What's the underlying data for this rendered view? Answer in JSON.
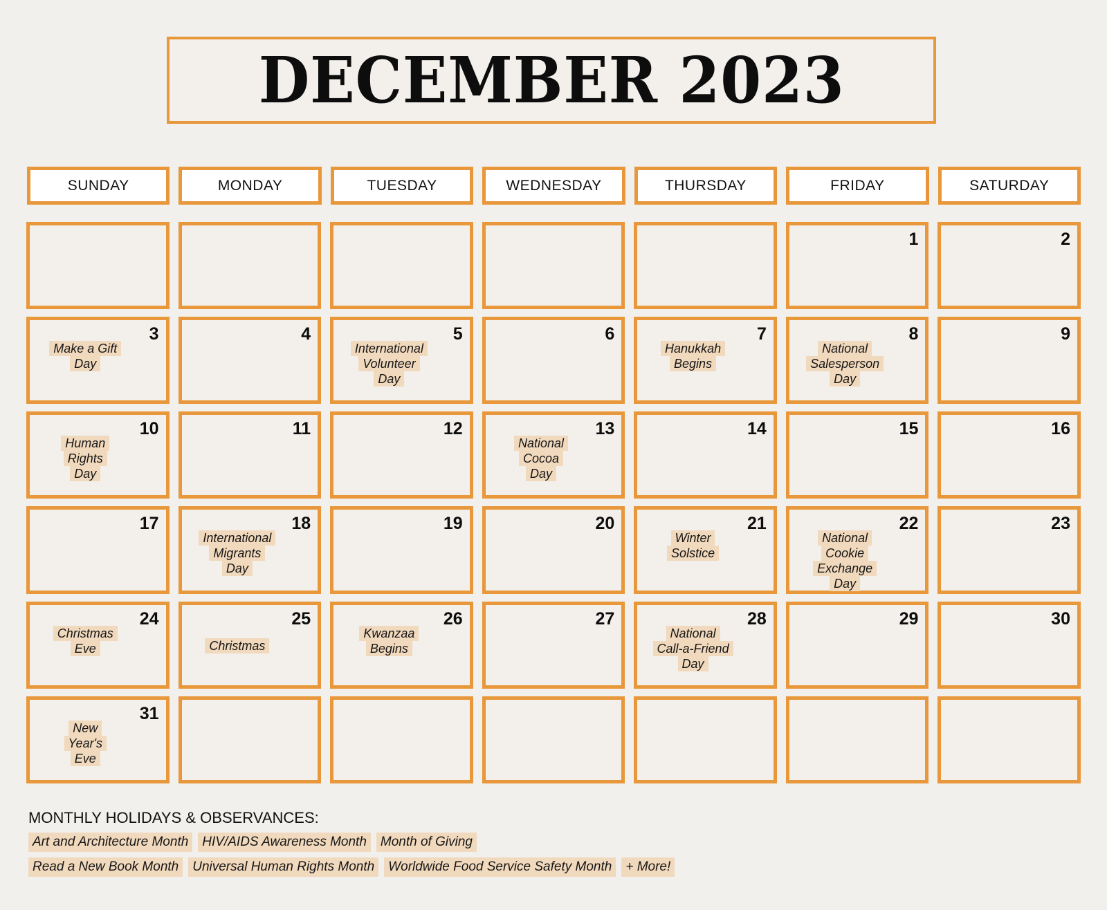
{
  "title": "DECEMBER 2023",
  "weekdays": [
    "SUNDAY",
    "MONDAY",
    "TUESDAY",
    "WEDNESDAY",
    "THURSDAY",
    "FRIDAY",
    "SATURDAY"
  ],
  "colors": {
    "border": "#e8983b",
    "highlight": "#f1d9bd",
    "background": "#f1f0ed"
  },
  "cells": [
    {
      "day": ""
    },
    {
      "day": ""
    },
    {
      "day": ""
    },
    {
      "day": ""
    },
    {
      "day": ""
    },
    {
      "day": "1"
    },
    {
      "day": "2"
    },
    {
      "day": "3",
      "event": [
        "Make a Gift",
        "Day"
      ]
    },
    {
      "day": "4"
    },
    {
      "day": "5",
      "event": [
        "International",
        "Volunteer",
        "Day"
      ]
    },
    {
      "day": "6"
    },
    {
      "day": "7",
      "event": [
        "Hanukkah",
        "Begins"
      ]
    },
    {
      "day": "8",
      "event": [
        "National",
        "Salesperson",
        "Day"
      ]
    },
    {
      "day": "9"
    },
    {
      "day": "10",
      "event": [
        "Human",
        "Rights",
        "Day"
      ]
    },
    {
      "day": "11"
    },
    {
      "day": "12"
    },
    {
      "day": "13",
      "event": [
        "National",
        "Cocoa",
        "Day"
      ]
    },
    {
      "day": "14"
    },
    {
      "day": "15"
    },
    {
      "day": "16"
    },
    {
      "day": "17"
    },
    {
      "day": "18",
      "event": [
        "International",
        "Migrants",
        "Day"
      ]
    },
    {
      "day": "19"
    },
    {
      "day": "20"
    },
    {
      "day": "21",
      "event": [
        "Winter",
        "Solstice"
      ]
    },
    {
      "day": "22",
      "event": [
        "National",
        "Cookie",
        "Exchange",
        "Day"
      ]
    },
    {
      "day": "23"
    },
    {
      "day": "24",
      "event": [
        "Christmas",
        "Eve"
      ]
    },
    {
      "day": "25",
      "event": [
        "Christmas"
      ]
    },
    {
      "day": "26",
      "event": [
        "Kwanzaa",
        "Begins"
      ]
    },
    {
      "day": "27"
    },
    {
      "day": "28",
      "event": [
        "National",
        "Call-a-Friend",
        "Day"
      ]
    },
    {
      "day": "29"
    },
    {
      "day": "30"
    },
    {
      "day": "31",
      "event": [
        "New",
        "Year's",
        "Eve"
      ]
    },
    {
      "day": ""
    },
    {
      "day": ""
    },
    {
      "day": ""
    },
    {
      "day": ""
    },
    {
      "day": ""
    },
    {
      "day": ""
    }
  ],
  "monthly": {
    "heading": "MONTHLY HOLIDAYS & OBSERVANCES:",
    "rows": [
      [
        "Art and Architecture Month",
        "HIV/AIDS Awareness Month",
        "Month of Giving"
      ],
      [
        "Read a New Book Month",
        "Universal Human Rights Month",
        "Worldwide Food Service Safety Month",
        "+ More!"
      ]
    ]
  }
}
